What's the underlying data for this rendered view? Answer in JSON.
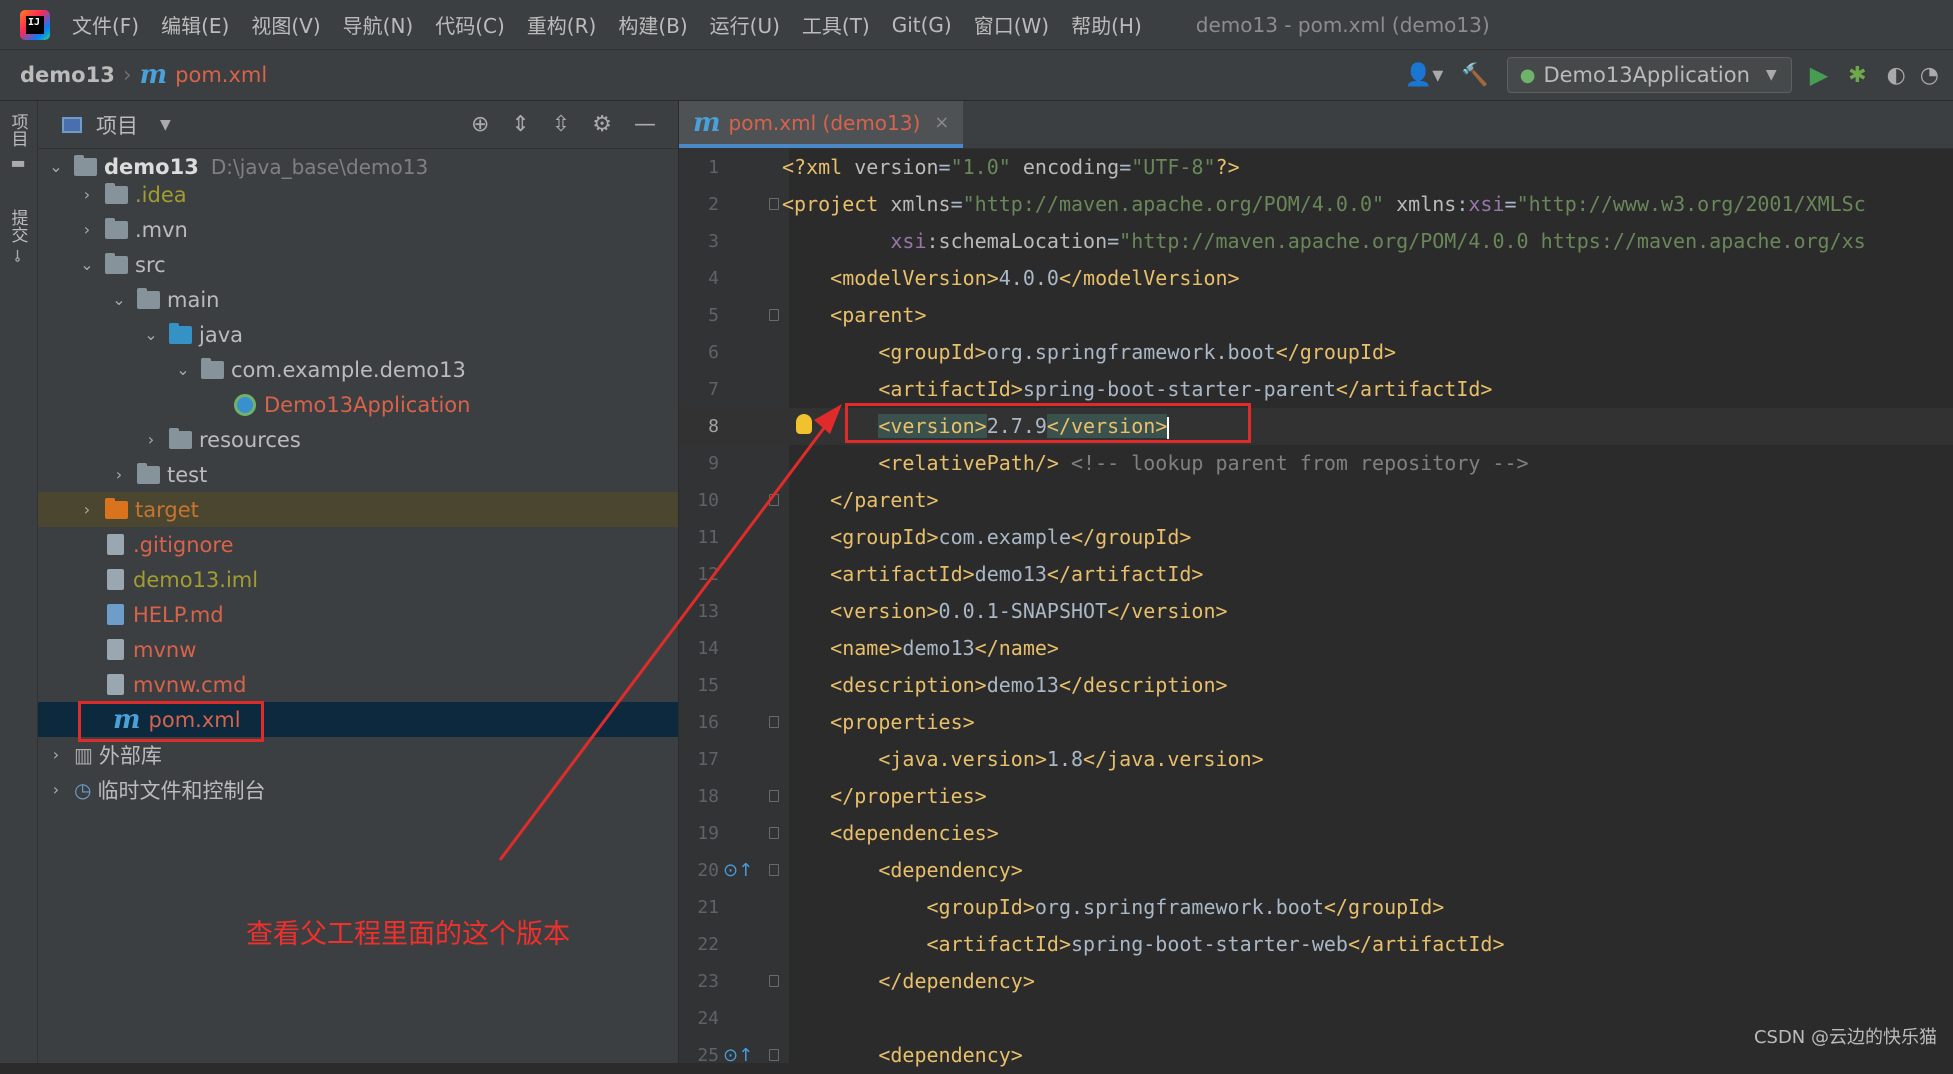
{
  "menu": {
    "items": [
      "文件(F)",
      "编辑(E)",
      "视图(V)",
      "导航(N)",
      "代码(C)",
      "重构(R)",
      "构建(B)",
      "运行(U)",
      "工具(T)",
      "Git(G)",
      "窗口(W)",
      "帮助(H)"
    ],
    "window_title": "demo13 - pom.xml (demo13)"
  },
  "navbar": {
    "project": "demo13",
    "file": "pom.xml",
    "run_config": "Demo13Application"
  },
  "left_strip": {
    "project_tab": "项目",
    "commit_tab": "提交"
  },
  "project_panel": {
    "title": "项目"
  },
  "tree": [
    {
      "label": "demo13",
      "path": "D:\\java_base\\demo13"
    },
    {
      "label": ".idea"
    },
    {
      "label": ".mvn"
    },
    {
      "label": "src"
    },
    {
      "label": "main"
    },
    {
      "label": "java"
    },
    {
      "label": "com.example.demo13"
    },
    {
      "label": "Demo13Application"
    },
    {
      "label": "resources"
    },
    {
      "label": "test"
    },
    {
      "label": "target"
    },
    {
      "label": ".gitignore"
    },
    {
      "label": "demo13.iml"
    },
    {
      "label": "HELP.md"
    },
    {
      "label": "mvnw"
    },
    {
      "label": "mvnw.cmd"
    },
    {
      "label": "pom.xml"
    },
    {
      "label": "外部库"
    },
    {
      "label": "临时文件和控制台"
    }
  ],
  "editor": {
    "tab_name": "pom.xml (demo13)",
    "current_line": 8,
    "line_numbers": [
      "1",
      "2",
      "3",
      "4",
      "5",
      "6",
      "7",
      "8",
      "9",
      "10",
      "11",
      "12",
      "13",
      "14",
      "15",
      "16",
      "17",
      "18",
      "19",
      "20",
      "21",
      "22",
      "23",
      "24",
      "25"
    ]
  },
  "annotation": {
    "text": "查看父工程里面的这个版本"
  },
  "watermark": "CSDN @云边的快乐猫",
  "colors": {
    "annotation_red": "#e02b2b",
    "tag": "#e8bf6a",
    "attr_value": "#6a8759",
    "comment": "#808080"
  }
}
